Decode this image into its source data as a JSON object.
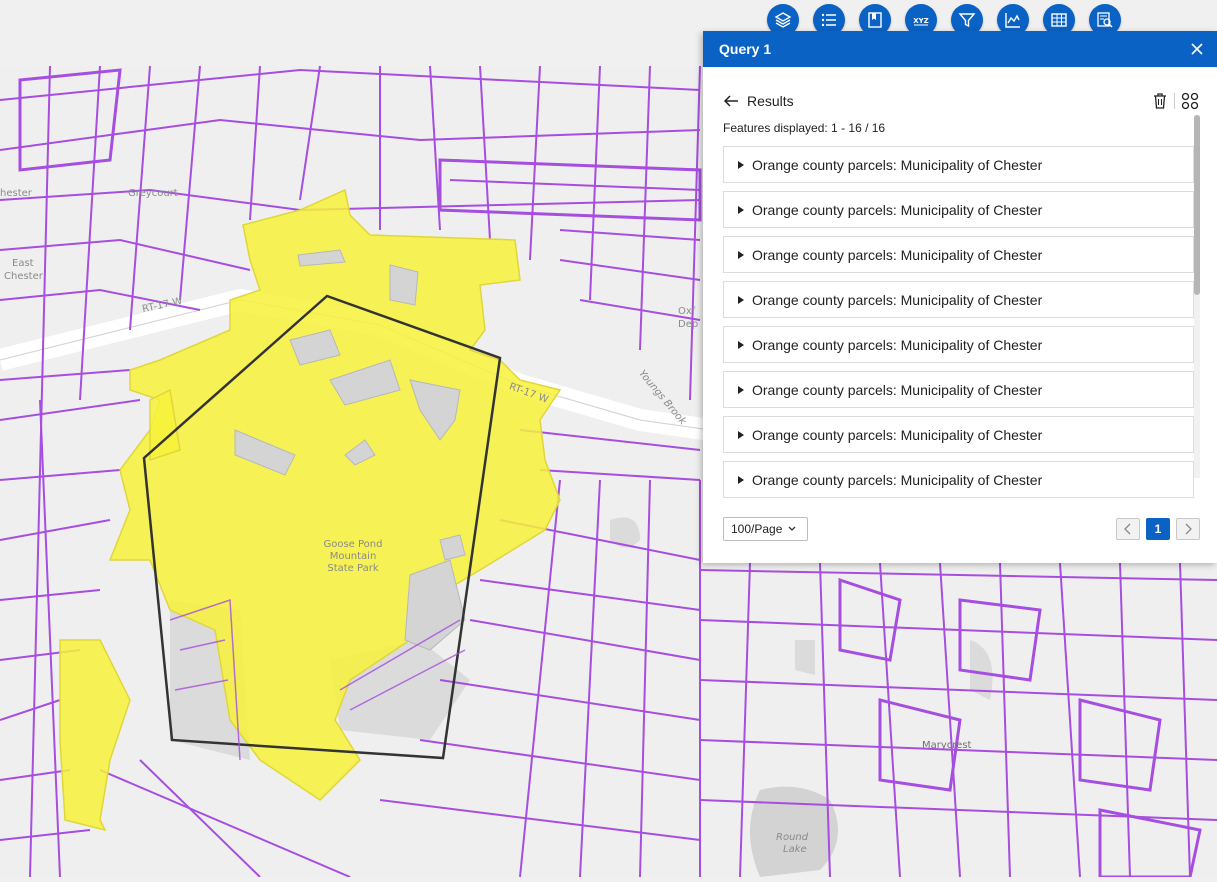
{
  "map": {
    "labels": {
      "chester": "hester",
      "greycourt": "Greycourt",
      "east_chester_1": "East",
      "east_chester_2": "Chester",
      "rt17_a": "RT-17 W",
      "rt17_b": "RT-17 W",
      "oxford_1": "Oxf",
      "oxford_2": "Dep",
      "youngs_brook": "Youngs Brook",
      "park_1": "Goose Pond",
      "park_2": "Mountain",
      "park_3": "State Park",
      "marycrest": "Marycrest",
      "round_lake_1": "Round",
      "round_lake_2": "Lake"
    }
  },
  "toolbar": {
    "items": [
      "layers-icon",
      "legend-icon",
      "bookmark-icon",
      "coordinates-icon",
      "filter-icon",
      "chart-icon",
      "table-icon",
      "query-icon"
    ]
  },
  "panel": {
    "title": "Query 1",
    "results_title": "Results",
    "features_displayed": "Features displayed: 1 - 16 / 16",
    "items": [
      "Orange county parcels: Municipality of Chester",
      "Orange county parcels: Municipality of Chester",
      "Orange county parcels: Municipality of Chester",
      "Orange county parcels: Municipality of Chester",
      "Orange county parcels: Municipality of Chester",
      "Orange county parcels: Municipality of Chester",
      "Orange county parcels: Municipality of Chester",
      "Orange county parcels: Municipality of Chester"
    ],
    "page_size": "100/Page",
    "current_page": "1"
  },
  "colors": {
    "accent": "#0a62c4",
    "parcel": "#a64ee0",
    "highlight": "#f7f23a"
  }
}
